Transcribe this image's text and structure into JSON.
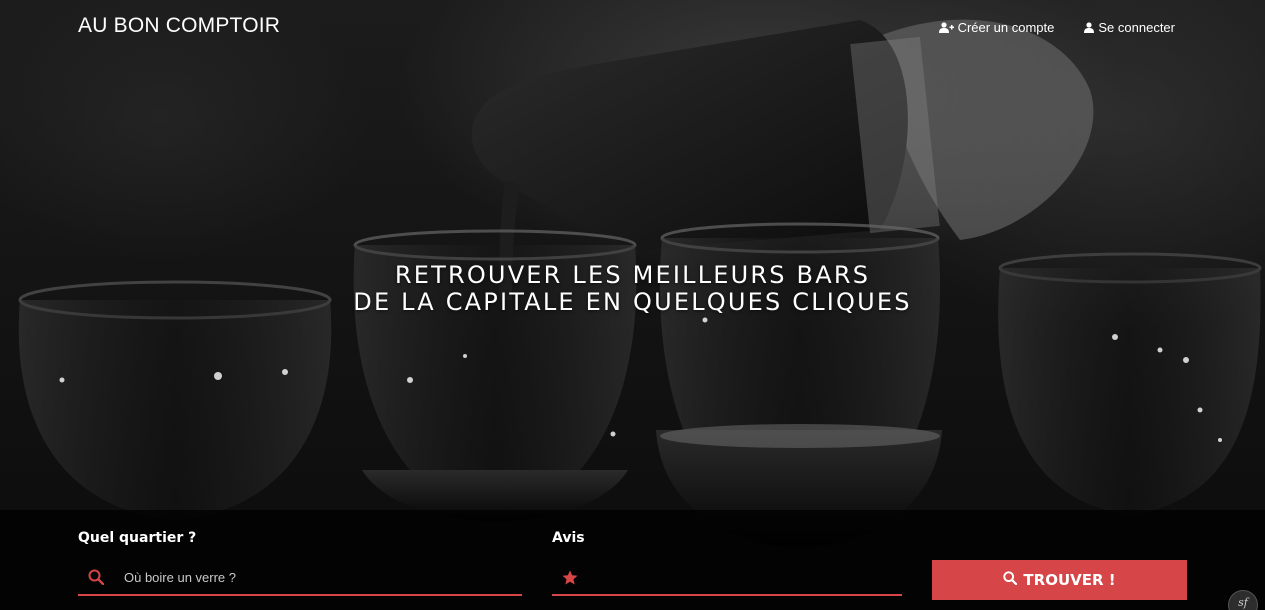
{
  "header": {
    "brand": "AU BON COMPTOIR",
    "nav": [
      {
        "label": "Créer un compte",
        "icon": "user-plus-icon"
      },
      {
        "label": "Se connecter",
        "icon": "user-icon"
      }
    ]
  },
  "hero": {
    "headline_line1": "RETROUVER LES MEILLEURS BARS",
    "headline_line2": "DE LA CAPITALE EN QUELQUES CLIQUES"
  },
  "search": {
    "district_label": "Quel quartier ?",
    "district_placeholder": "Où boire un verre ?",
    "district_icon": "search-icon",
    "rating_label": "Avis",
    "rating_icon": "star-icon",
    "submit_label": "TROUVER !",
    "submit_icon": "search-icon"
  },
  "colors": {
    "accent": "#d64548",
    "bar_background": "#000000"
  }
}
